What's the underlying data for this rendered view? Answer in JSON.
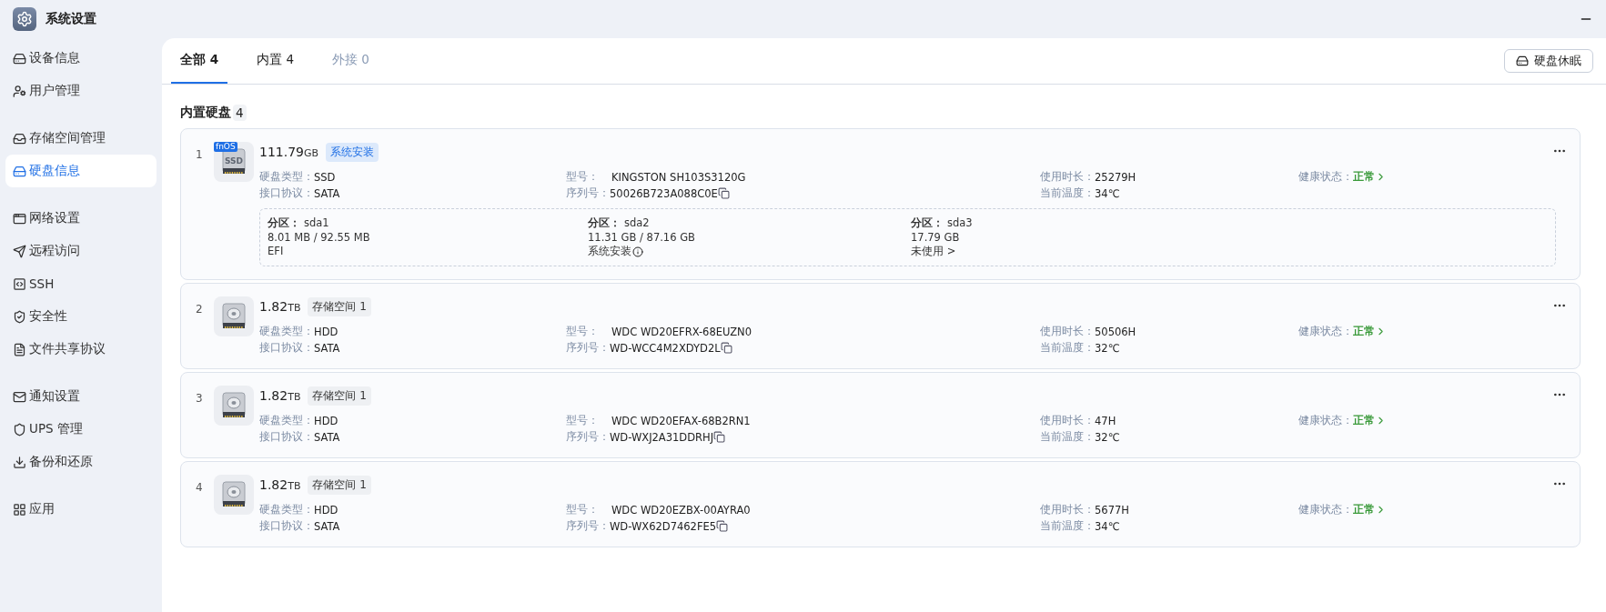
{
  "window": {
    "title": "系统设置"
  },
  "sidebar": {
    "groups": [
      [
        {
          "label": "设备信息",
          "selected": false
        },
        {
          "label": "用户管理",
          "selected": false
        }
      ],
      [
        {
          "label": "存储空间管理",
          "selected": false
        },
        {
          "label": "硬盘信息",
          "selected": true
        }
      ],
      [
        {
          "label": "网络设置",
          "selected": false
        },
        {
          "label": "远程访问",
          "selected": false
        },
        {
          "label": "SSH",
          "selected": false
        },
        {
          "label": "安全性",
          "selected": false
        },
        {
          "label": "文件共享协议",
          "selected": false
        }
      ],
      [
        {
          "label": "通知设置",
          "selected": false
        },
        {
          "label": "UPS 管理",
          "selected": false
        },
        {
          "label": "备份和还原",
          "selected": false
        }
      ],
      [
        {
          "label": "应用",
          "selected": false
        }
      ]
    ]
  },
  "tabs": [
    {
      "label": "全部 4",
      "selected": true,
      "disabled": false
    },
    {
      "label": "内置 4",
      "selected": false,
      "disabled": false
    },
    {
      "label": "外接 0",
      "selected": false,
      "disabled": true
    }
  ],
  "sleep_button": {
    "label": "硬盘休眠"
  },
  "section": {
    "title": "内置硬盘",
    "count": "4"
  },
  "disks": [
    {
      "number": "1",
      "capacity": "111.79",
      "unit": "GB",
      "drive": {
        "kind": "ssd",
        "badge": "fnOS",
        "label": "SSD"
      },
      "tag": {
        "label": "系统安装",
        "kind": "system"
      },
      "type_label": "硬盘类型：",
      "type": "SSD",
      "interface_label": "接口协议：",
      "interface": "SATA",
      "model_label": "型号：",
      "model": "KINGSTON SH103S3120G",
      "serial_label": "序列号：",
      "serial": "50026B723A088C0E",
      "hours_label": "使用时长：",
      "hours": "25279H",
      "temp_label": "当前温度：",
      "temp": "34℃",
      "health_label": "健康状态：",
      "health": "正常",
      "partitions": [
        {
          "label": "分区：",
          "name": "sda1",
          "size": "8.01 MB / 92.55 MB",
          "note": "EFI",
          "info": false
        },
        {
          "label": "分区：",
          "name": "sda2",
          "size": "11.31 GB / 87.16 GB",
          "note": "系统安装",
          "info": true
        },
        {
          "label": "分区：",
          "name": "sda3",
          "size": "17.79 GB",
          "note": "未使用 >",
          "info": false
        }
      ]
    },
    {
      "number": "2",
      "capacity": "1.82",
      "unit": "TB",
      "drive": {
        "kind": "hdd"
      },
      "tag": {
        "label": "存储空间 1",
        "kind": "pool"
      },
      "type_label": "硬盘类型：",
      "type": "HDD",
      "interface_label": "接口协议：",
      "interface": "SATA",
      "model_label": "型号：",
      "model": "WDC WD20EFRX-68EUZN0",
      "serial_label": "序列号：",
      "serial": "WD-WCC4M2XDYD2L",
      "hours_label": "使用时长：",
      "hours": "50506H",
      "temp_label": "当前温度：",
      "temp": "32℃",
      "health_label": "健康状态：",
      "health": "正常"
    },
    {
      "number": "3",
      "capacity": "1.82",
      "unit": "TB",
      "drive": {
        "kind": "hdd"
      },
      "tag": {
        "label": "存储空间 1",
        "kind": "pool"
      },
      "type_label": "硬盘类型：",
      "type": "HDD",
      "interface_label": "接口协议：",
      "interface": "SATA",
      "model_label": "型号：",
      "model": "WDC WD20EFAX-68B2RN1",
      "serial_label": "序列号：",
      "serial": "WD-WXJ2A31DDRHJ",
      "hours_label": "使用时长：",
      "hours": "47H",
      "temp_label": "当前温度：",
      "temp": "32℃",
      "health_label": "健康状态：",
      "health": "正常"
    },
    {
      "number": "4",
      "capacity": "1.82",
      "unit": "TB",
      "drive": {
        "kind": "hdd"
      },
      "tag": {
        "label": "存储空间 1",
        "kind": "pool"
      },
      "type_label": "硬盘类型：",
      "type": "HDD",
      "interface_label": "接口协议：",
      "interface": "SATA",
      "model_label": "型号：",
      "model": "WDC WD20EZBX-00AYRA0",
      "serial_label": "序列号：",
      "serial": "WD-WX62D7462FE5",
      "hours_label": "使用时长：",
      "hours": "5677H",
      "temp_label": "当前温度：",
      "temp": "34℃",
      "health_label": "健康状态：",
      "health": "正常"
    }
  ]
}
